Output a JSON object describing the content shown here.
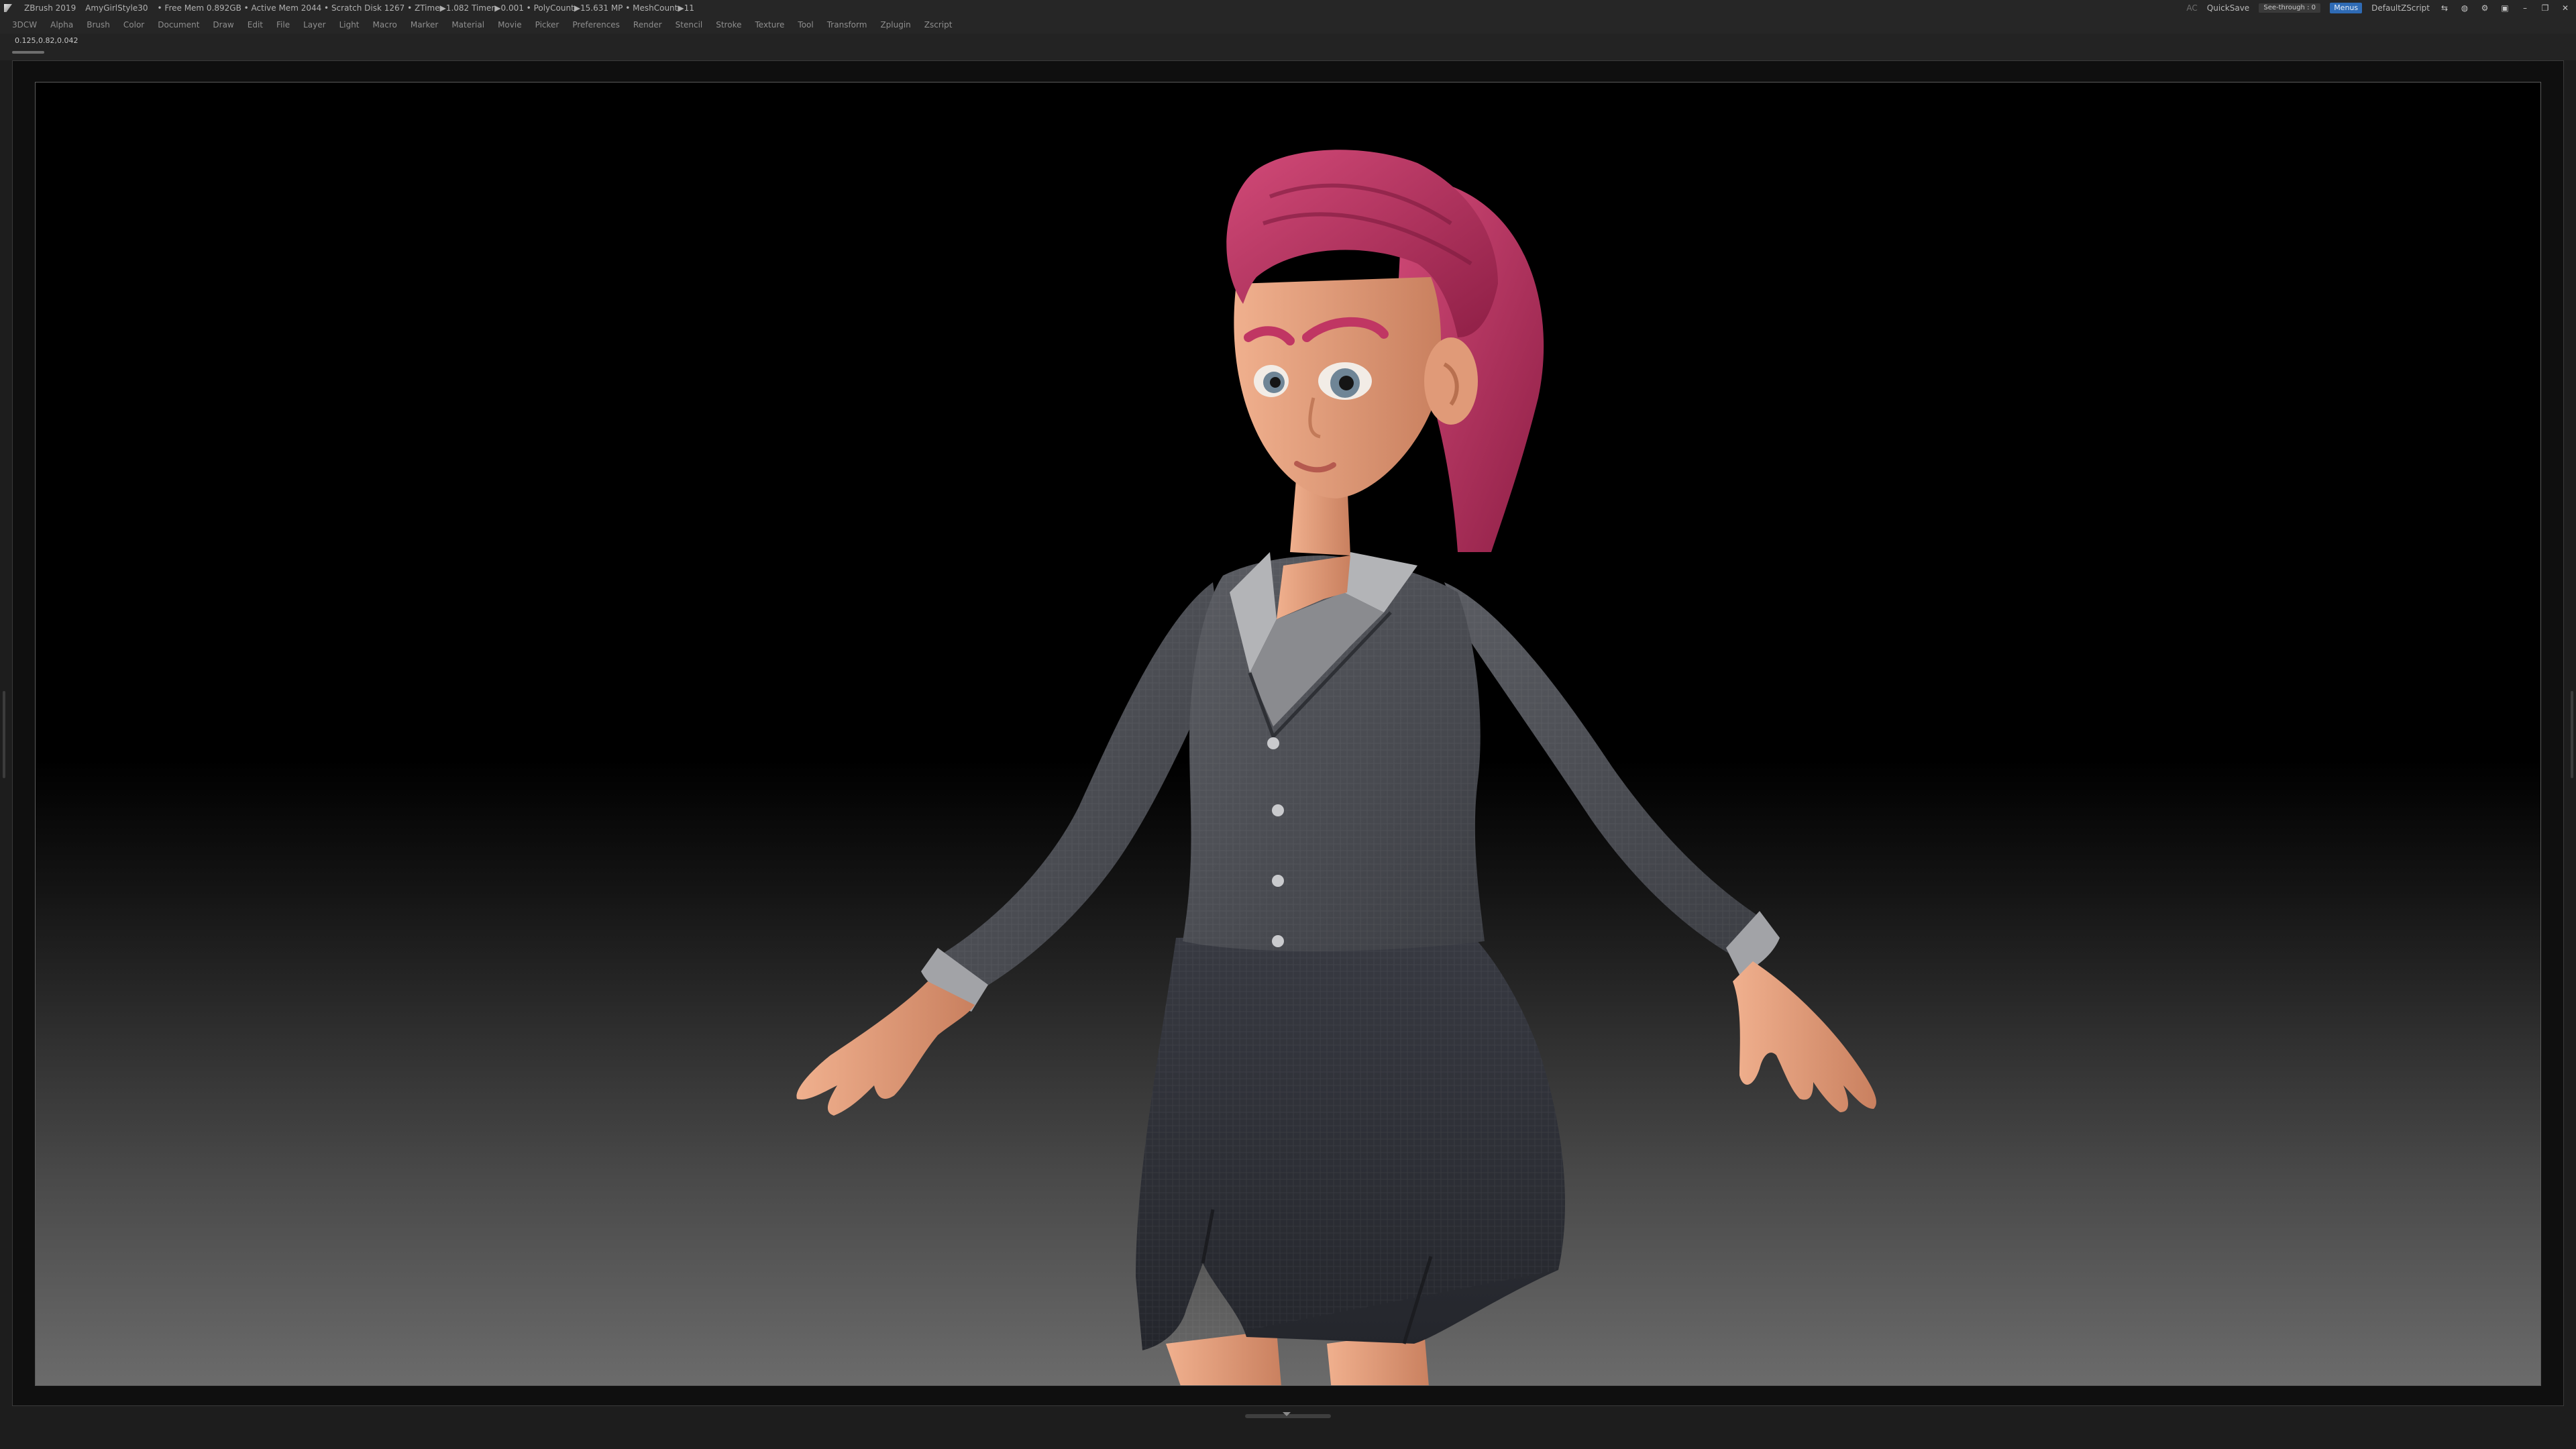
{
  "titlebar": {
    "app_name": "ZBrush 2019",
    "project": "AmyGirlStyle30",
    "stats": "• Free Mem 0.892GB • Active Mem 2044 • Scratch Disk 1267 • ZTime▶1.082 Timer▶0.001 • PolyCount▶15.631 MP • MeshCount▶11",
    "ac_label": "AC",
    "quicksave": "QuickSave",
    "see_through_label": "See-through",
    "see_through_value": "0",
    "see_through_fraction": 0.0,
    "menus_label": "Menus",
    "default_script": "DefaultZScript",
    "icons": [
      "layout-icon",
      "palette-icon",
      "ui-icon",
      "lock-icon",
      "minimize-icon",
      "restore-icon",
      "close-icon"
    ]
  },
  "menubar": {
    "items": [
      "3DCW",
      "Alpha",
      "Brush",
      "Color",
      "Document",
      "Draw",
      "Edit",
      "File",
      "Layer",
      "Light",
      "Macro",
      "Marker",
      "Material",
      "Movie",
      "Picker",
      "Preferences",
      "Render",
      "Stencil",
      "Stroke",
      "Texture",
      "Tool",
      "Transform",
      "Zplugin",
      "Zscript"
    ]
  },
  "info": {
    "coordinates": "0.125,0.82,0.042"
  },
  "colors": {
    "accent": "#2f6bb5",
    "see_through_bar": "#e8a33b",
    "hair": "#b8325f",
    "skin": "#e8a07e",
    "jacket": "#4d4f55",
    "skirt": "#2e3038",
    "blouse": "#a7a8ab"
  }
}
